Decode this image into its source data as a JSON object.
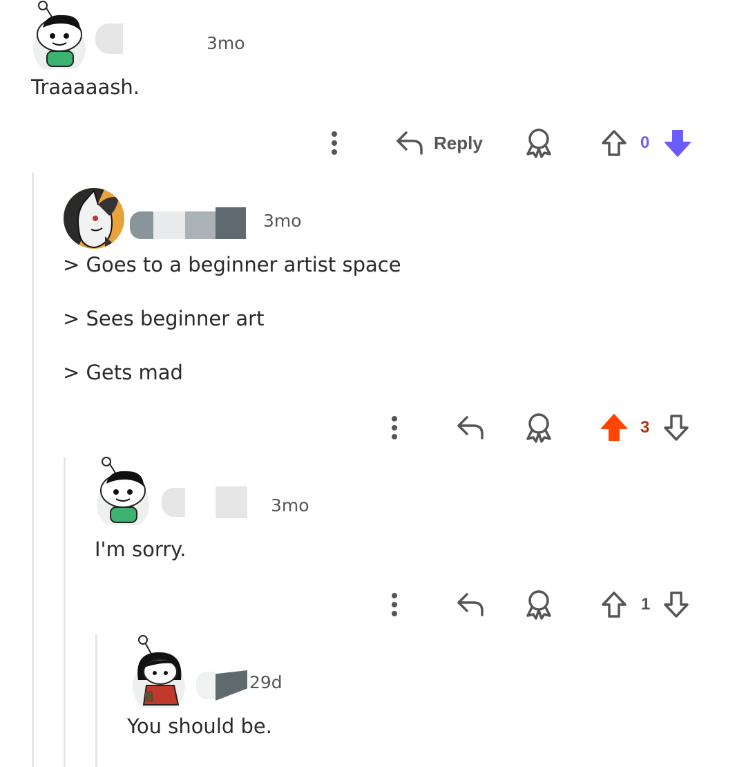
{
  "comments": [
    {
      "time": "3mo",
      "body": [
        "Traaaaash."
      ],
      "actions": {
        "reply_label": "Reply",
        "score": "0",
        "vote_state": "downvoted",
        "score_color": "#6a5cff",
        "down_color": "#6a5cff"
      },
      "avatar_icon": "snoo-avatar-green-shirt-icon"
    },
    {
      "time": "3mo",
      "body": [
        "> Goes to a beginner artist space",
        "> Sees beginner art",
        "> Gets mad"
      ],
      "actions": {
        "score": "3",
        "vote_state": "upvoted",
        "score_color": "#b3360e",
        "up_color": "#ff4500"
      },
      "avatar_icon": "fox-character-avatar-icon"
    },
    {
      "time": "3mo",
      "body": [
        "I'm sorry."
      ],
      "actions": {
        "score": "1",
        "vote_state": "none"
      },
      "avatar_icon": "snoo-avatar-green-shirt-icon"
    },
    {
      "time": "29d",
      "body": [
        "You should be."
      ],
      "avatar_icon": "snoo-avatar-red-dress-icon"
    }
  ],
  "colors": {
    "thread_line": "#e6e6e6",
    "icon_gray": "#555555",
    "upvote_orange": "#ff4500",
    "downvote_purple": "#6a5cff"
  }
}
